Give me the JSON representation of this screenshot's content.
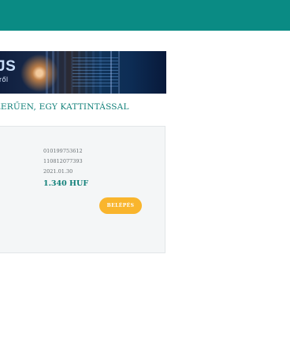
{
  "header": {
    "bar_color": "#0a8b84"
  },
  "banner": {
    "heading_fragment": "JS",
    "subheading_fragment": "tről"
  },
  "slogan": "SZERŰEN, EGY KATTINTÁSSAL",
  "invoice_card": {
    "line1": "010199753612",
    "line2": "110812077393",
    "date": "2021.01.30",
    "amount": "1.340 HUF",
    "login_button": "BELÉPÉS",
    "button_color": "#f9b52d"
  }
}
